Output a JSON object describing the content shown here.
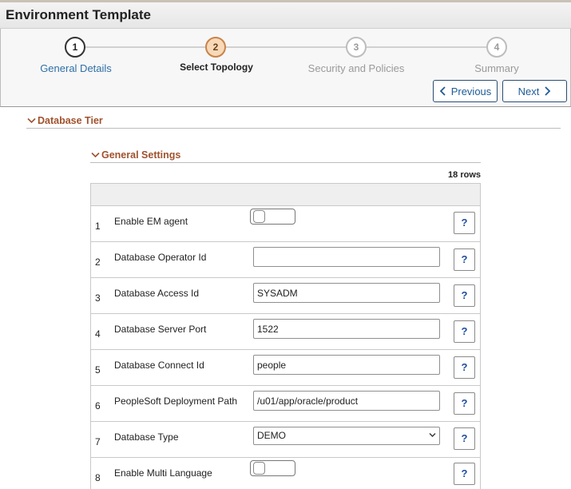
{
  "page": {
    "title": "Environment Template"
  },
  "train": {
    "steps": [
      {
        "number": "1",
        "label": "General Details"
      },
      {
        "number": "2",
        "label": "Select Topology"
      },
      {
        "number": "3",
        "label": "Security and Policies"
      },
      {
        "number": "4",
        "label": "Summary"
      }
    ],
    "previous_label": "Previous",
    "next_label": "Next"
  },
  "sections": {
    "database_tier": "Database Tier",
    "general_settings": "General Settings"
  },
  "grid": {
    "row_count": "18 rows",
    "rows": [
      {
        "num": "1",
        "label": "Enable EM agent",
        "type": "toggle",
        "checked": false
      },
      {
        "num": "2",
        "label": "Database Operator Id",
        "type": "text",
        "value": ""
      },
      {
        "num": "3",
        "label": "Database Access Id",
        "type": "text",
        "value": "SYSADM"
      },
      {
        "num": "4",
        "label": "Database Server Port",
        "type": "text",
        "value": "1522"
      },
      {
        "num": "5",
        "label": "Database Connect Id",
        "type": "text",
        "value": "people"
      },
      {
        "num": "6",
        "label": "PeopleSoft Deployment Path",
        "type": "text",
        "value": "/u01/app/oracle/product"
      },
      {
        "num": "7",
        "label": "Database Type",
        "type": "select",
        "value": "DEMO"
      },
      {
        "num": "8",
        "label": "Enable Multi Language",
        "type": "toggle",
        "checked": false
      }
    ],
    "help_label": "?"
  },
  "icons": {
    "chevron_left": "chevron-left-icon",
    "chevron_right": "chevron-right-icon",
    "chevron_down": "chevron-down-icon"
  },
  "colors": {
    "link": "#2f6fa6",
    "current_step_fill": "#f8d9b7",
    "section_header": "#a0522d",
    "help_text": "#1f4fa0"
  }
}
